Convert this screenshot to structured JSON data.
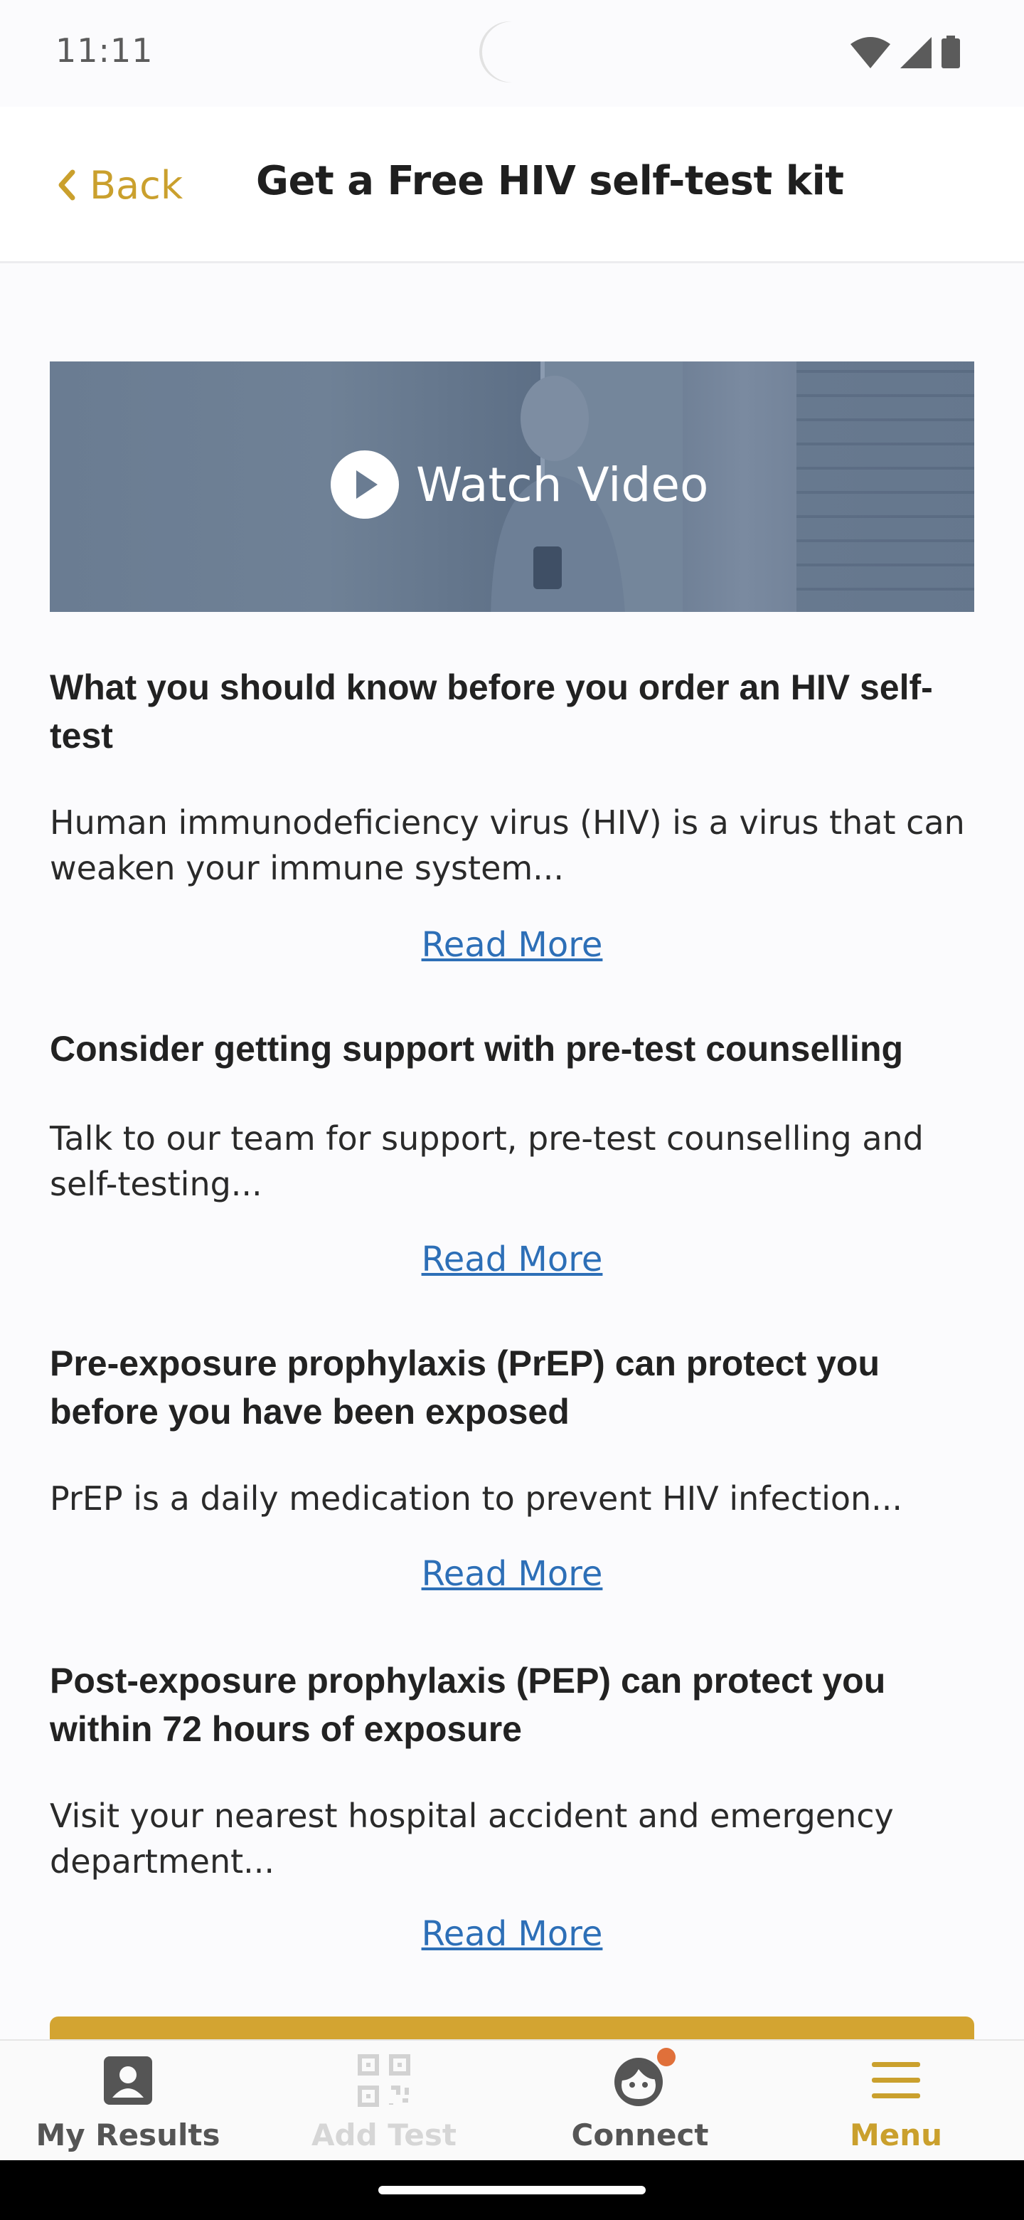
{
  "status_bar": {
    "time": "11:11"
  },
  "header": {
    "back_label": "Back",
    "title": "Get a Free HIV self-test kit"
  },
  "video": {
    "label": "Watch Video"
  },
  "sections": [
    {
      "title": "What you should know before you order an HIV self-test",
      "body": "Human immunodeficiency virus (HIV) is a virus that can weaken your immune system...",
      "link": "Read More"
    },
    {
      "title": "Consider getting support with pre-test counselling",
      "body": "Talk to our team for support, pre-test counselling and self-testing...",
      "link": "Read More"
    },
    {
      "title": "Pre-exposure prophylaxis (PrEP) can protect you before you have been exposed",
      "body": "PrEP is a daily medication to prevent HIV infection...",
      "link": "Read More"
    },
    {
      "title": "Post-exposure prophylaxis (PEP) can protect you within 72 hours of exposure",
      "body": "Visit your nearest hospital accident and emergency department...",
      "link": "Read More"
    }
  ],
  "bottom_nav": {
    "items": [
      {
        "label": "My Results",
        "icon": "person-card-icon",
        "state": "default"
      },
      {
        "label": "Add Test",
        "icon": "qr-code-icon",
        "state": "disabled"
      },
      {
        "label": "Connect",
        "icon": "chat-face-icon",
        "state": "default",
        "badge": true
      },
      {
        "label": "Menu",
        "icon": "hamburger-menu-icon",
        "state": "active"
      }
    ]
  },
  "colors": {
    "accent": "#caa02d",
    "link": "#2d6fb7",
    "text": "#222222",
    "disabled": "#cfcfcf",
    "nav_default": "#555555",
    "badge": "#e0703a"
  }
}
